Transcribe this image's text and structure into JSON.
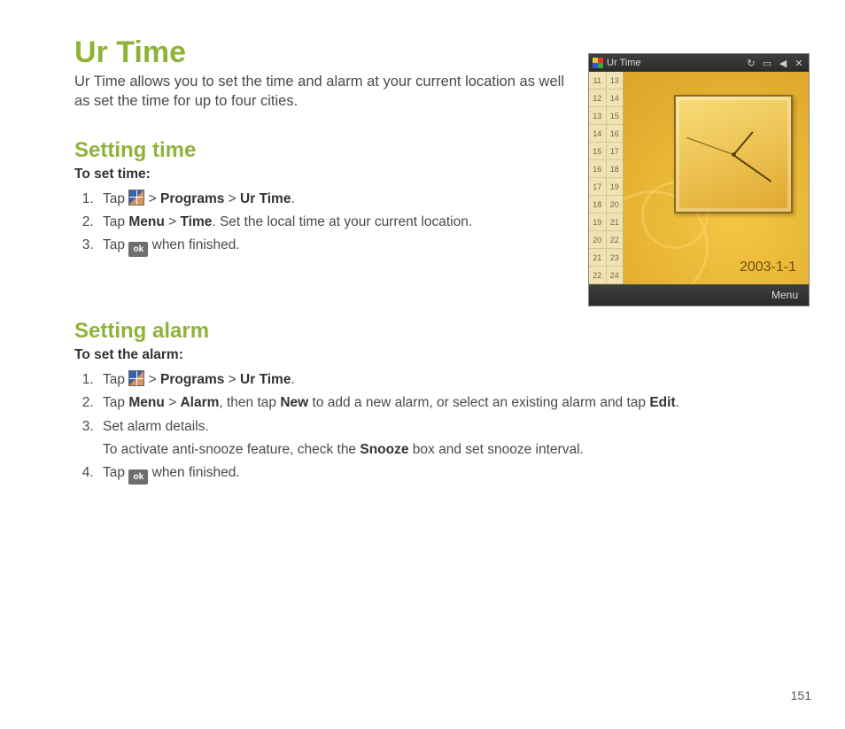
{
  "title": "Ur Time",
  "intro": "Ur Time allows you to set the time and alarm at your current location as well  as set the time for up to four cities.",
  "section_time": {
    "heading": "Setting time",
    "sub": "To set time:",
    "s1_pre": "Tap ",
    "s1_gt1": " > ",
    "s1_b1": "Programs",
    "s1_gt2": " > ",
    "s1_b2": "Ur Time",
    "s1_post": ".",
    "s2_pre": "Tap ",
    "s2_b1": "Menu",
    "s2_gt": " > ",
    "s2_b2": "Time",
    "s2_post": ". Set the local time at your current location.",
    "s3_pre": "Tap ",
    "s3_ok": "ok",
    "s3_post": " when finished."
  },
  "section_alarm": {
    "heading": "Setting alarm",
    "sub": "To set the alarm:",
    "s1_pre": "Tap ",
    "s1_gt1": " > ",
    "s1_b1": "Programs",
    "s1_gt2": " > ",
    "s1_b2": "Ur Time",
    "s1_post": ".",
    "s2_pre": "Tap ",
    "s2_b1": "Menu",
    "s2_gt1": " > ",
    "s2_b2": "Alarm",
    "s2_mid1": ", then tap ",
    "s2_b3": "New",
    "s2_mid2": " to add a new alarm, or select an existing alarm and tap ",
    "s2_b4": "Edit",
    "s2_post": ".",
    "s3_line1": "Set alarm details.",
    "s3_line2a": "To activate anti-snooze feature, check the ",
    "s3_b": "Snooze",
    "s3_line2b": " box and set snooze interval.",
    "s4_pre": "Tap ",
    "s4_ok": "ok",
    "s4_post": " when finished."
  },
  "screenshot": {
    "title": "Ur Time",
    "date": "2003-1-1",
    "menu": "Menu",
    "list": [
      [
        "11",
        "13"
      ],
      [
        "12",
        "14"
      ],
      [
        "13",
        "15"
      ],
      [
        "14",
        "16"
      ],
      [
        "15",
        "17"
      ],
      [
        "16",
        "18"
      ],
      [
        "17",
        "19"
      ],
      [
        "18",
        "20"
      ],
      [
        "19",
        "21"
      ],
      [
        "20",
        "22"
      ],
      [
        "21",
        "23"
      ],
      [
        "22",
        "24"
      ]
    ]
  },
  "page_number": "151"
}
